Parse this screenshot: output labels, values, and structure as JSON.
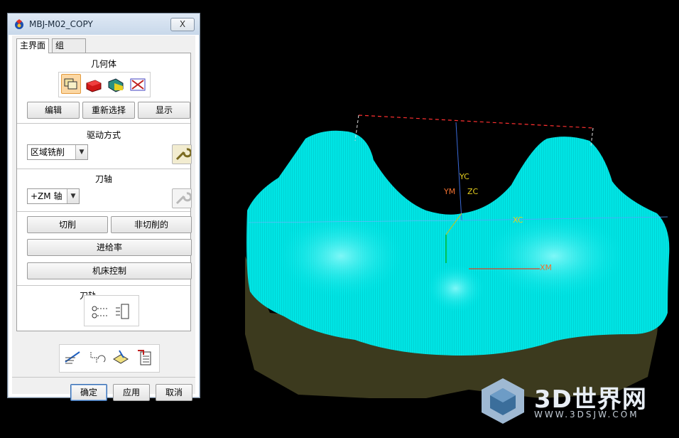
{
  "window": {
    "title": "MBJ-M02_COPY",
    "close_label": "X"
  },
  "tabs": [
    {
      "label": "主界面"
    },
    {
      "label": "组"
    }
  ],
  "geometry": {
    "title": "几何体",
    "icons": [
      "geometry-icon",
      "part-body-icon",
      "blank-body-icon",
      "check-body-icon"
    ],
    "buttons": {
      "edit": "编辑",
      "reselect": "重新选择",
      "display": "显示"
    }
  },
  "drive": {
    "title": "驱动方式",
    "method": "区域铣削",
    "edit_icon": "wrench-icon"
  },
  "tool_axis": {
    "title": "刀轴",
    "axis": "+ZM 轴",
    "edit_icon": "wrench-disabled-icon"
  },
  "params": {
    "cutting": "切削",
    "non_cutting": "非切削的",
    "feeds": "进给率",
    "machine_control": "机床控制"
  },
  "toolpath": {
    "title": "刀轨",
    "icons": [
      "toolpath-settings-icon",
      "toolpath-list-icon"
    ]
  },
  "actions": {
    "icons": [
      "generate-icon",
      "replay-icon",
      "verify-icon",
      "list-icon"
    ]
  },
  "footer": {
    "ok": "确定",
    "apply": "应用",
    "cancel": "取消"
  },
  "viewport": {
    "axis_labels": {
      "yc": "YC",
      "ym": "YM",
      "zc": "ZC",
      "xm": "XM",
      "xc": "XC"
    },
    "watermark": {
      "title": "3D世界网",
      "url": "WWW.3DSJW.COM"
    },
    "colors": {
      "background": "#000000",
      "toolpath": "#00e5e5",
      "blank": "#3c3a1e"
    }
  }
}
